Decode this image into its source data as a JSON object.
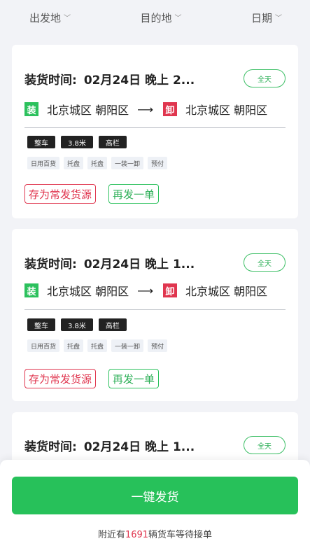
{
  "filters": [
    {
      "label": "出发地"
    },
    {
      "label": "目的地"
    },
    {
      "label": "日期"
    }
  ],
  "cards": [
    {
      "load_time_label": "装货时间:",
      "load_time_value": "02月24日 晚上 2...",
      "badge": "全天",
      "load_tag": "装",
      "origin": "北京城区 朝阳区",
      "arrow": "⟶",
      "unload_tag": "卸",
      "destination": "北京城区 朝阳区",
      "specs": [
        "整车",
        "3.8米",
        "高栏"
      ],
      "goods": [
        "日用百货",
        "托盘",
        "托盘",
        "一装一卸",
        "预付"
      ],
      "save_label": "存为常发货源",
      "again_label": "再发一单"
    },
    {
      "load_time_label": "装货时间:",
      "load_time_value": "02月24日 晚上 1...",
      "badge": "全天",
      "load_tag": "装",
      "origin": "北京城区 朝阳区",
      "arrow": "⟶",
      "unload_tag": "卸",
      "destination": "北京城区 朝阳区",
      "specs": [
        "整车",
        "3.8米",
        "高栏"
      ],
      "goods": [
        "日用百货",
        "托盘",
        "托盘",
        "一装一卸",
        "预付"
      ],
      "save_label": "存为常发货源",
      "again_label": "再发一单"
    },
    {
      "load_time_label": "装货时间:",
      "load_time_value": "02月24日 晚上 1...",
      "badge": "全天"
    }
  ],
  "bottom": {
    "ship_label": "一键发货",
    "nearby_prefix": "附近有",
    "nearby_count": "1691",
    "nearby_suffix": "辆货车等待接单"
  },
  "colors": {
    "accent_green": "#27c15a",
    "accent_red": "#e0364f"
  }
}
